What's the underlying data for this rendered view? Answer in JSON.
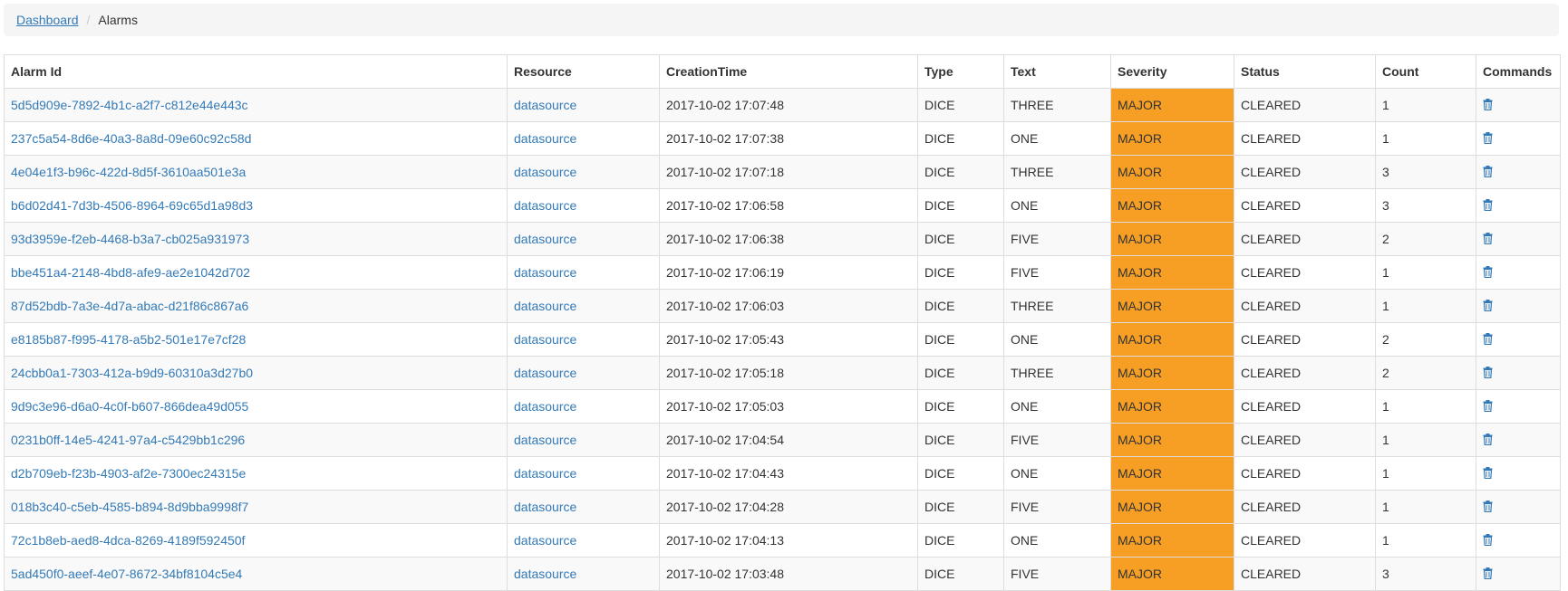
{
  "breadcrumb": {
    "home_label": "Dashboard",
    "current_label": "Alarms"
  },
  "table": {
    "headers": {
      "alarm_id": "Alarm Id",
      "resource": "Resource",
      "creation_time": "CreationTime",
      "type": "Type",
      "text": "Text",
      "severity": "Severity",
      "status": "Status",
      "count": "Count",
      "commands": "Commands"
    },
    "rows": [
      {
        "alarm_id": "5d5d909e-7892-4b1c-a2f7-c812e44e443c",
        "resource": "datasource",
        "creation_time": "2017-10-02 17:07:48",
        "type": "DICE",
        "text": "THREE",
        "severity": "MAJOR",
        "status": "CLEARED",
        "count": "1"
      },
      {
        "alarm_id": "237c5a54-8d6e-40a3-8a8d-09e60c92c58d",
        "resource": "datasource",
        "creation_time": "2017-10-02 17:07:38",
        "type": "DICE",
        "text": "ONE",
        "severity": "MAJOR",
        "status": "CLEARED",
        "count": "1"
      },
      {
        "alarm_id": "4e04e1f3-b96c-422d-8d5f-3610aa501e3a",
        "resource": "datasource",
        "creation_time": "2017-10-02 17:07:18",
        "type": "DICE",
        "text": "THREE",
        "severity": "MAJOR",
        "status": "CLEARED",
        "count": "3"
      },
      {
        "alarm_id": "b6d02d41-7d3b-4506-8964-69c65d1a98d3",
        "resource": "datasource",
        "creation_time": "2017-10-02 17:06:58",
        "type": "DICE",
        "text": "ONE",
        "severity": "MAJOR",
        "status": "CLEARED",
        "count": "3"
      },
      {
        "alarm_id": "93d3959e-f2eb-4468-b3a7-cb025a931973",
        "resource": "datasource",
        "creation_time": "2017-10-02 17:06:38",
        "type": "DICE",
        "text": "FIVE",
        "severity": "MAJOR",
        "status": "CLEARED",
        "count": "2"
      },
      {
        "alarm_id": "bbe451a4-2148-4bd8-afe9-ae2e1042d702",
        "resource": "datasource",
        "creation_time": "2017-10-02 17:06:19",
        "type": "DICE",
        "text": "FIVE",
        "severity": "MAJOR",
        "status": "CLEARED",
        "count": "1"
      },
      {
        "alarm_id": "87d52bdb-7a3e-4d7a-abac-d21f86c867a6",
        "resource": "datasource",
        "creation_time": "2017-10-02 17:06:03",
        "type": "DICE",
        "text": "THREE",
        "severity": "MAJOR",
        "status": "CLEARED",
        "count": "1"
      },
      {
        "alarm_id": "e8185b87-f995-4178-a5b2-501e17e7cf28",
        "resource": "datasource",
        "creation_time": "2017-10-02 17:05:43",
        "type": "DICE",
        "text": "ONE",
        "severity": "MAJOR",
        "status": "CLEARED",
        "count": "2"
      },
      {
        "alarm_id": "24cbb0a1-7303-412a-b9d9-60310a3d27b0",
        "resource": "datasource",
        "creation_time": "2017-10-02 17:05:18",
        "type": "DICE",
        "text": "THREE",
        "severity": "MAJOR",
        "status": "CLEARED",
        "count": "2"
      },
      {
        "alarm_id": "9d9c3e96-d6a0-4c0f-b607-866dea49d055",
        "resource": "datasource",
        "creation_time": "2017-10-02 17:05:03",
        "type": "DICE",
        "text": "ONE",
        "severity": "MAJOR",
        "status": "CLEARED",
        "count": "1"
      },
      {
        "alarm_id": "0231b0ff-14e5-4241-97a4-c5429bb1c296",
        "resource": "datasource",
        "creation_time": "2017-10-02 17:04:54",
        "type": "DICE",
        "text": "FIVE",
        "severity": "MAJOR",
        "status": "CLEARED",
        "count": "1"
      },
      {
        "alarm_id": "d2b709eb-f23b-4903-af2e-7300ec24315e",
        "resource": "datasource",
        "creation_time": "2017-10-02 17:04:43",
        "type": "DICE",
        "text": "ONE",
        "severity": "MAJOR",
        "status": "CLEARED",
        "count": "1"
      },
      {
        "alarm_id": "018b3c40-c5eb-4585-b894-8d9bba9998f7",
        "resource": "datasource",
        "creation_time": "2017-10-02 17:04:28",
        "type": "DICE",
        "text": "FIVE",
        "severity": "MAJOR",
        "status": "CLEARED",
        "count": "1"
      },
      {
        "alarm_id": "72c1b8eb-aed8-4dca-8269-4189f592450f",
        "resource": "datasource",
        "creation_time": "2017-10-02 17:04:13",
        "type": "DICE",
        "text": "ONE",
        "severity": "MAJOR",
        "status": "CLEARED",
        "count": "1"
      },
      {
        "alarm_id": "5ad450f0-aeef-4e07-8672-34bf8104c5e4",
        "resource": "datasource",
        "creation_time": "2017-10-02 17:03:48",
        "type": "DICE",
        "text": "FIVE",
        "severity": "MAJOR",
        "status": "CLEARED",
        "count": "3"
      }
    ],
    "delete_icon": "trash-icon"
  },
  "colors": {
    "link": "#337ab7",
    "severity_major": "#f79f24",
    "stripe": "#f9f9f9",
    "border": "#dddddd",
    "breadcrumb_bg": "#f5f5f5"
  }
}
